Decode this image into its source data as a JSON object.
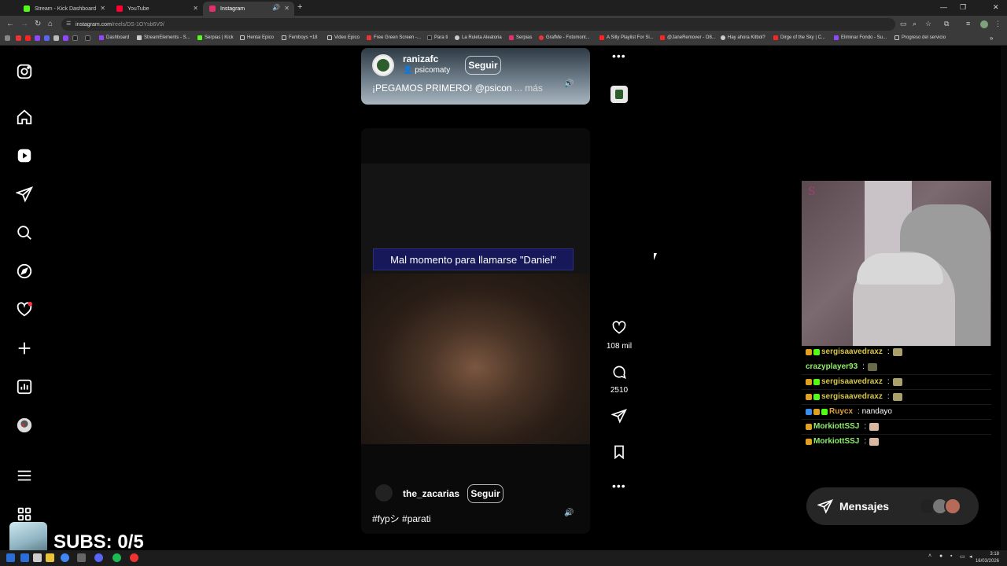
{
  "browser": {
    "tabs": [
      {
        "label": "Stream - Kick Dashboard",
        "color": "#53fc18"
      },
      {
        "label": "YouTube",
        "color": "#ff0033"
      },
      {
        "label": "Instagram",
        "color": "#e1306c"
      }
    ],
    "url_host": "instagram.com",
    "url_path": "/reels/DS-1OYsb6V9/",
    "bookmarks": [
      "Dashboard",
      "StreamElements - S...",
      "Serpias | Kick",
      "Hentai Epico",
      "Femboys +18",
      "Video Epico",
      "Free Green Screen -...",
      "Para ti",
      "La Ruleta Aleatoria",
      "Serpias",
      "GrafMe - Fotomont...",
      "A Silly Playlist For Si...",
      "@JaneRemover - O8...",
      "Hay ahora Kitbol?",
      "Dirge of the Sky | C...",
      "Eliminar Fondo - Su...",
      "Progreso del servicio"
    ]
  },
  "sidebar": {
    "items": [
      {
        "icon": "instagram-logo-icon"
      },
      {
        "icon": "home-icon"
      },
      {
        "icon": "reels-icon"
      },
      {
        "icon": "direct-message-icon"
      },
      {
        "icon": "search-icon"
      },
      {
        "icon": "explore-icon"
      },
      {
        "icon": "notifications-heart-icon"
      },
      {
        "icon": "create-plus-icon"
      },
      {
        "icon": "dashboard-icon"
      },
      {
        "icon": "profile-avatar-icon"
      },
      {
        "icon": "more-menu-icon"
      },
      {
        "icon": "also-from-meta-icon"
      }
    ]
  },
  "reel_previous": {
    "username": "ranizafc",
    "collab": "psicomaty",
    "follow_label": "Seguir",
    "caption": "¡PEGAMOS PRIMERO! @psicon",
    "more_label": "... más"
  },
  "reel_current": {
    "overlay_text": "Mal momento para llamarse \"Daniel\"",
    "username": "the_zacarias",
    "follow_label": "Seguir",
    "caption": "#fypシ #parati",
    "likes": "108 mil",
    "comments": "2510"
  },
  "chat": {
    "messages": [
      {
        "user": "sergisaavedraxz",
        "color": "#d6c64a",
        "text": ":"
      },
      {
        "user": "crazyplayer93",
        "color": "#8ff06b",
        "text": ":"
      },
      {
        "user": "sergisaavedraxz",
        "color": "#d6c64a",
        "text": ":"
      },
      {
        "user": "sergisaavedraxz",
        "color": "#d6c64a",
        "text": ":"
      },
      {
        "user": "Ruycx",
        "color": "#e0a040",
        "text": ": nandayo"
      },
      {
        "user": "MorkiottSSJ",
        "color": "#8ff06b",
        "text": ":"
      },
      {
        "user": "MorkiottSSJ",
        "color": "#8ff06b",
        "text": ":"
      }
    ]
  },
  "messages_button": {
    "label": "Mensajes"
  },
  "overlay": {
    "subs": "SUBS: 0/5"
  },
  "taskbar": {
    "time": "3:18",
    "date": "16/03/2026"
  }
}
